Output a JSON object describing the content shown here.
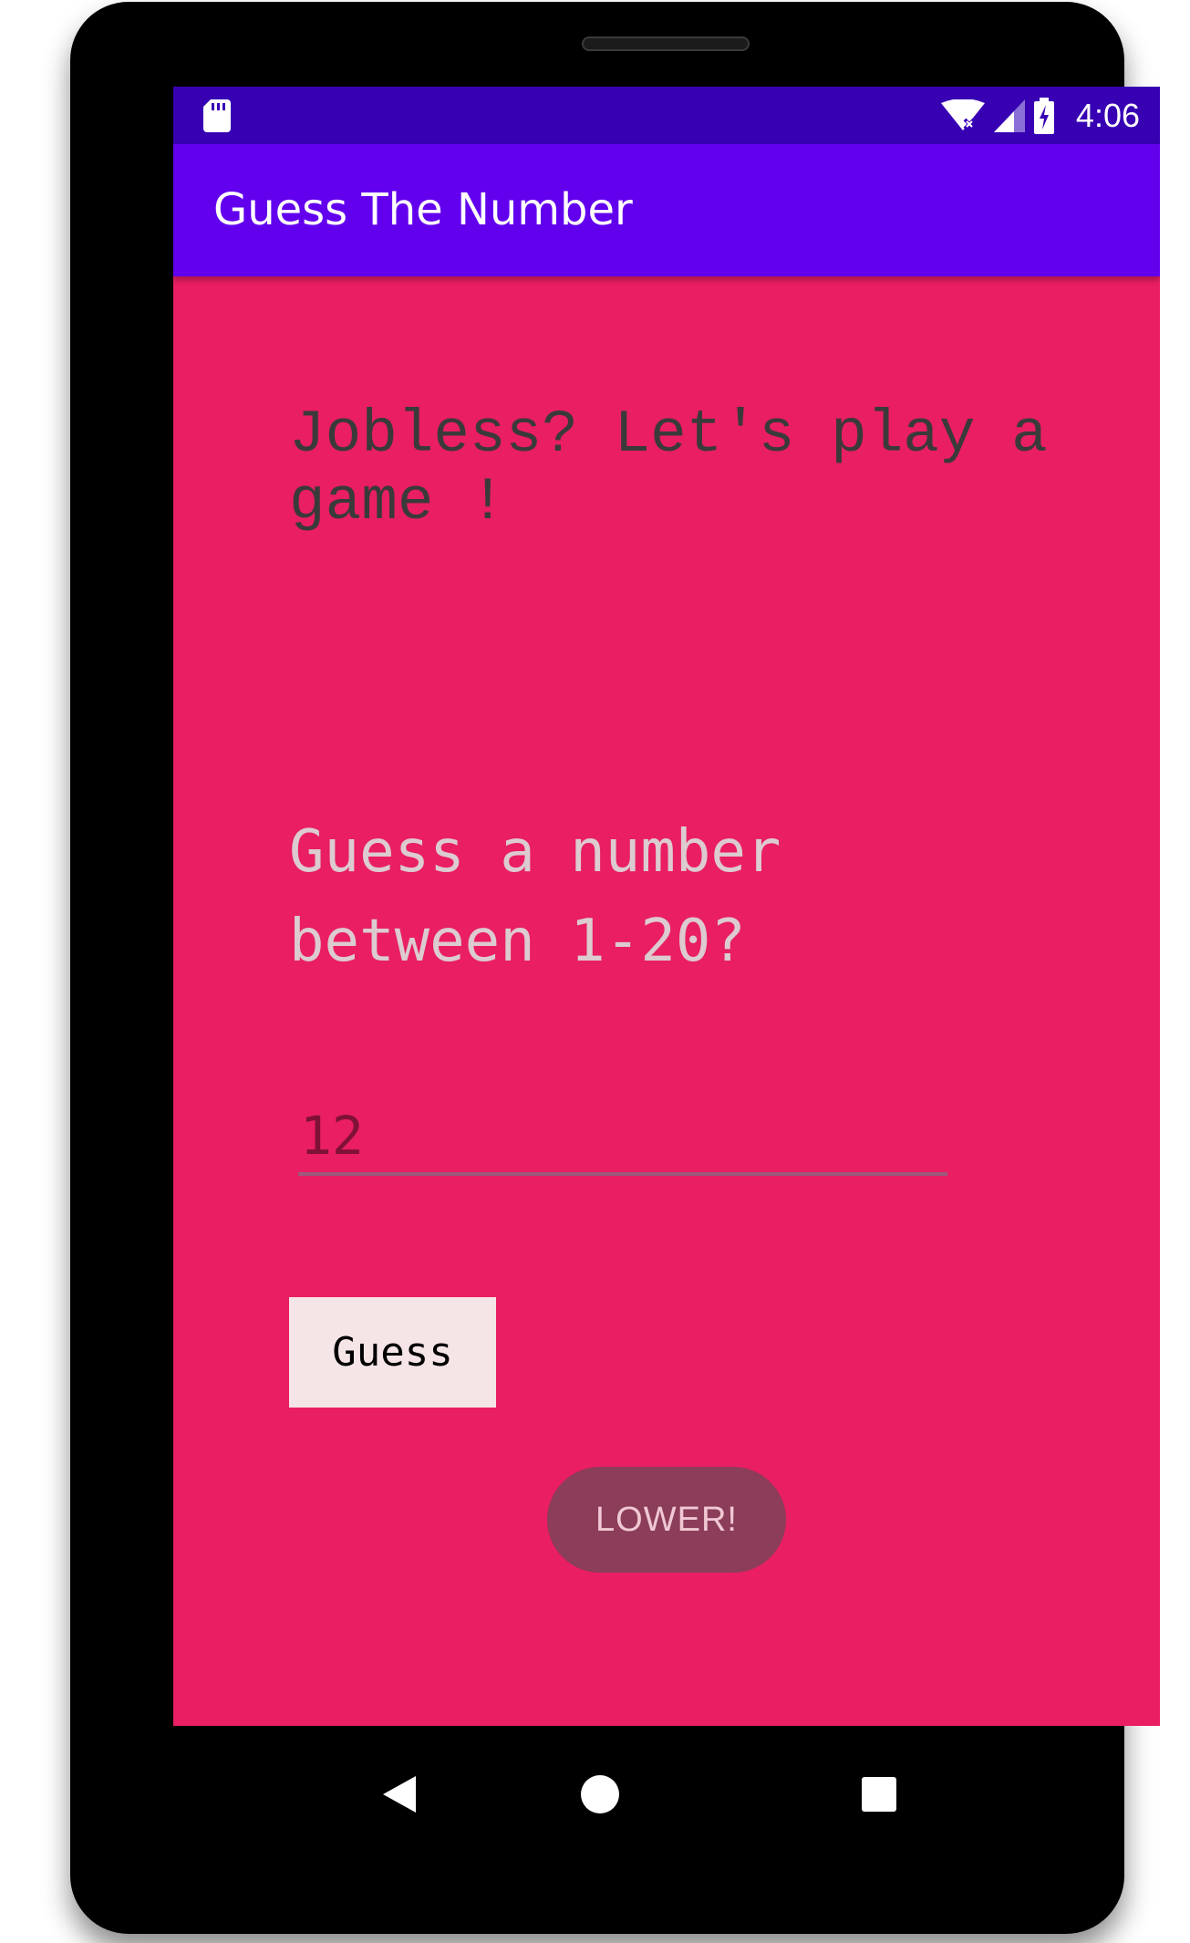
{
  "status_bar": {
    "time": "4:06",
    "icons": [
      "sd-card-icon",
      "wifi-icon",
      "signal-icon",
      "battery-charging-icon"
    ],
    "background_color": "#3700b3"
  },
  "app_bar": {
    "title": "Guess The Number",
    "background_color": "#6200ee"
  },
  "main": {
    "background_color": "#e91e63",
    "headline": "Jobless? Let's play a game !",
    "prompt": "Guess a number between 1-20?",
    "input": {
      "value": "12",
      "placeholder": ""
    },
    "guess_button_label": "Guess",
    "result_label": "LOWER!"
  },
  "nav_bar": {
    "buttons": [
      "back-icon",
      "home-icon",
      "recents-icon"
    ]
  }
}
